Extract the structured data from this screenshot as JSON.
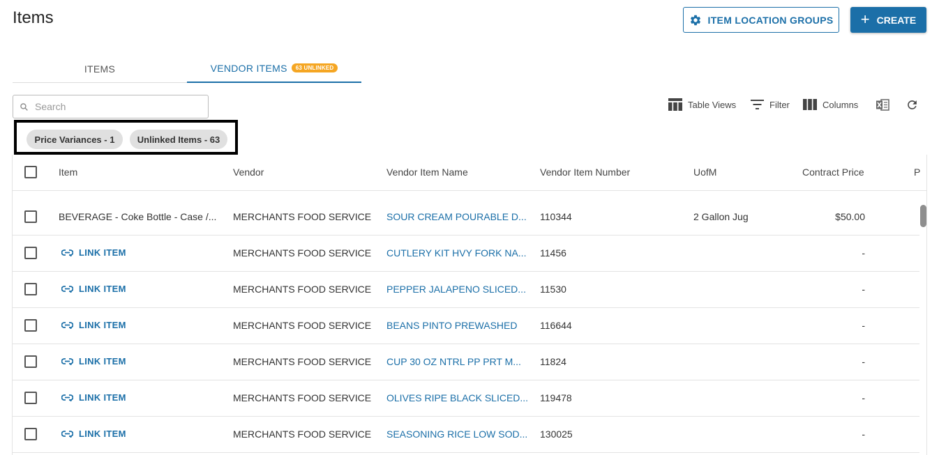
{
  "page": {
    "title": "Items"
  },
  "header": {
    "location_groups_label": "ITEM LOCATION GROUPS",
    "create_label": "CREATE"
  },
  "tabs": {
    "items_label": "ITEMS",
    "vendor_items_label": "VENDOR ITEMS",
    "vendor_items_badge": "63 UNLINKED"
  },
  "search": {
    "placeholder": "Search"
  },
  "toolbar": {
    "table_views": "Table Views",
    "filter": "Filter",
    "columns": "Columns"
  },
  "chips": [
    "Price Variances - 1",
    "Unlinked Items - 63"
  ],
  "table": {
    "columns": [
      "Item",
      "Vendor",
      "Vendor Item Name",
      "Vendor Item Number",
      "UofM",
      "Contract Price",
      "P"
    ],
    "link_item_label": "LINK ITEM",
    "rows": [
      {
        "item": "BEVERAGE - Coke Bottle - Case /...",
        "vendor": "MERCHANTS FOOD SERVICE",
        "vendor_item_name": "SOUR CREAM POURABLE D...",
        "vendor_item_number": "110344",
        "uofm": "2 Gallon Jug",
        "contract_price": "$50.00"
      },
      {
        "item": "",
        "vendor": "MERCHANTS FOOD SERVICE",
        "vendor_item_name": "CUTLERY KIT HVY FORK NA...",
        "vendor_item_number": "11456",
        "uofm": "",
        "contract_price": "-"
      },
      {
        "item": "",
        "vendor": "MERCHANTS FOOD SERVICE",
        "vendor_item_name": "PEPPER JALAPENO SLICED...",
        "vendor_item_number": "11530",
        "uofm": "",
        "contract_price": "-"
      },
      {
        "item": "",
        "vendor": "MERCHANTS FOOD SERVICE",
        "vendor_item_name": "BEANS PINTO PREWASHED",
        "vendor_item_number": "116644",
        "uofm": "",
        "contract_price": "-"
      },
      {
        "item": "",
        "vendor": "MERCHANTS FOOD SERVICE",
        "vendor_item_name": "CUP 30 OZ NTRL PP PRT M...",
        "vendor_item_number": "11824",
        "uofm": "",
        "contract_price": "-"
      },
      {
        "item": "",
        "vendor": "MERCHANTS FOOD SERVICE",
        "vendor_item_name": "OLIVES RIPE BLACK SLICED...",
        "vendor_item_number": "119478",
        "uofm": "",
        "contract_price": "-"
      },
      {
        "item": "",
        "vendor": "MERCHANTS FOOD SERVICE",
        "vendor_item_name": "SEASONING RICE LOW SOD...",
        "vendor_item_number": "130025",
        "uofm": "",
        "contract_price": "-"
      }
    ]
  },
  "colors": {
    "primary": "#1b6fa8",
    "badge": "#f5a623",
    "chip": "#e0e0e0"
  },
  "icons": [
    "gear-icon",
    "plus-icon",
    "search-icon",
    "table-views-icon",
    "filter-icon",
    "columns-icon",
    "excel-export-icon",
    "refresh-icon",
    "link-icon"
  ]
}
